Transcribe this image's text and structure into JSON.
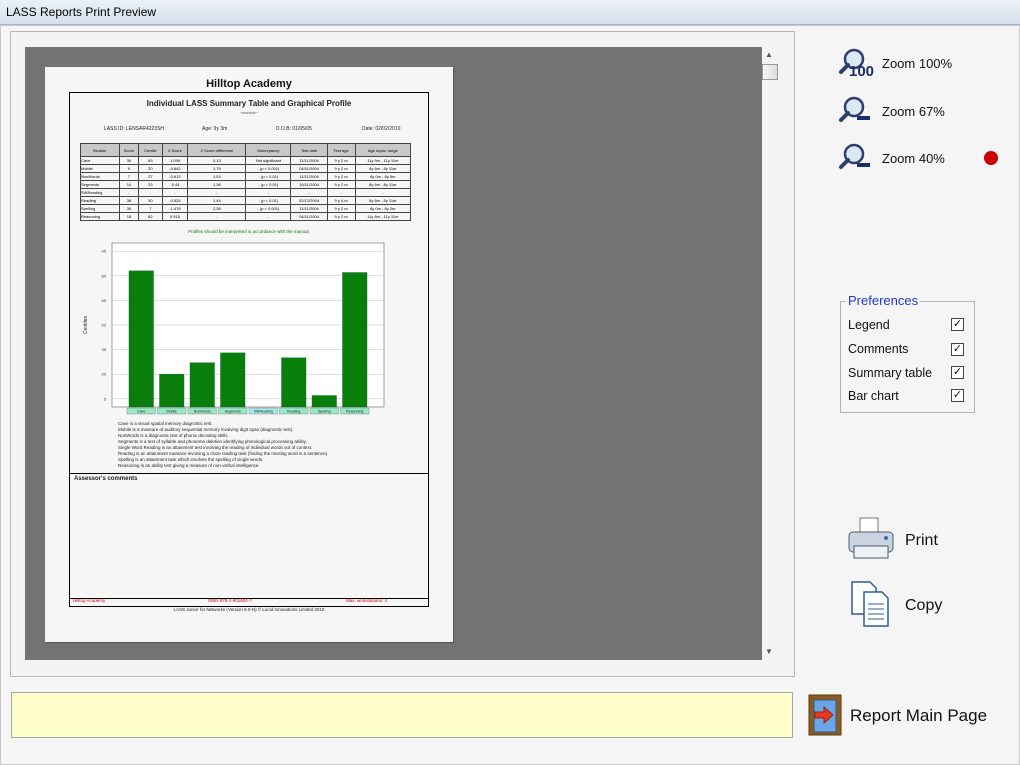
{
  "window": {
    "title": "LASS Reports Print Preview"
  },
  "zoom": {
    "items": [
      {
        "label": "Zoom 100%",
        "badge": "100"
      },
      {
        "label": "Zoom 67%",
        "badge": ""
      },
      {
        "label": "Zoom 40%",
        "badge": ""
      }
    ],
    "active_indicator_color": "#cc0000"
  },
  "preferences": {
    "title": "Preferences",
    "items": [
      {
        "label": "Legend",
        "checked": true
      },
      {
        "label": "Comments",
        "checked": true
      },
      {
        "label": "Summary table",
        "checked": true
      },
      {
        "label": "Bar chart",
        "checked": true
      }
    ],
    "check_glyph": "✓"
  },
  "actions": {
    "print_label": "Print",
    "copy_label": "Copy",
    "main_page_label": "Report Main Page"
  },
  "report": {
    "school": "Hilltop Academy",
    "title": "Individual LASS Summary Table and Graphical Profile",
    "subtitle": "~scribble~",
    "info_id": "LASS ID: LENSAR4223SH",
    "info_age": "Age:  9y  3m",
    "info_dob": "D.O.B: 01/05/05",
    "info_date": "Date: 02/02/2010",
    "table": {
      "headers": [
        "Module",
        "Score",
        "Centile",
        "Z Score",
        "Z Score difference",
        "Discrepancy",
        "Test date",
        "Test age",
        "Age equiv. range"
      ],
      "rows": [
        [
          "Cave",
          "30",
          "83",
          "1.099",
          "0.13",
          "Not significant",
          "11/11/2004",
          "9 y 2 m",
          "11y 9m - 11y 11m"
        ],
        [
          "Mobile",
          "9",
          "20",
          "-0.842",
          "1.79",
          "- (p < 0.001)",
          "04/11/2004",
          "9 y 2 m",
          "8y 6m - 8y 11m"
        ],
        [
          "NonWords",
          "7",
          "27",
          "-0.613",
          "1.53",
          "- (p < 0.01)",
          "11/11/2004",
          "9 y 2 m",
          "8y 0m - 8y 5m"
        ],
        [
          "Segments",
          "14",
          "33",
          "-0.44",
          "1.36",
          "- (p < 0.01)",
          "19/11/2004",
          "9 y 2 m",
          "8y 6m - 8y 11m"
        ],
        [
          "SWReading",
          "-",
          "-",
          "-",
          "-",
          "-",
          "-",
          "-",
          "-"
        ],
        [
          "Reading",
          "38",
          "30",
          "-0.525",
          "1.44",
          "- (p < 0.01)",
          "02/12/2004",
          "9 y 4 m",
          "8y 6m - 8y 11m"
        ],
        [
          "Spelling",
          "30",
          "7",
          "-1.476",
          "2.38",
          "- (p < 0.001)",
          "11/11/2004",
          "9 y 2 m",
          "8y 0m - 8y 2m"
        ],
        [
          "Reasoning",
          "18",
          "82",
          "0.915",
          "-",
          "-",
          "04/11/2004",
          "9 y 2 m",
          "11y 6m - 11y 11m"
        ]
      ]
    },
    "profile_note": "Profiles should be interpreted in accordance with the manual.",
    "legend_lines": [
      "Cave is a visual spatial memory diagnostic test.",
      "Mobile is a measure of auditory sequential memory involving digit span (diagnostic test).",
      "NonWords is a diagnostic test of phonic decoding skills.",
      "Segments is a test of syllable and phoneme deletion identifying phonological processing ability.",
      "Single Word Reading is an attainment test involving the reading of individual words out of context.",
      "Reading is an attainment measure involving a cloze reading task (finding the missing word in a sentence).",
      "Spelling is an attainment task which involves the spelling of single words.",
      "Reasoning is an ability test giving a measure of non-verbal intelligence."
    ],
    "comments_title": "Assessor's comments",
    "footer_left": "Hilltop Academy",
    "footer_mid": "ISBN 978-1-901604-?",
    "footer_right": "Max. workstations: 4",
    "copyright": "LASS Junior for Networks (Version 6.0-N)   © Lucid Innovations Limited 2010"
  },
  "chart_data": {
    "type": "bar",
    "ylabel": "Centiles",
    "yticks": [
      5,
      20,
      35,
      50,
      65,
      80,
      95
    ],
    "ylim": [
      0,
      100
    ],
    "categories": [
      "Cave",
      "Mobile",
      "NonWords",
      "Segments",
      "SWReading",
      "Reading",
      "Spelling",
      "Reasoning"
    ],
    "values": [
      83,
      20,
      27,
      33,
      null,
      30,
      7,
      82
    ],
    "bar_color": "#0a7e0a",
    "label_bg_colors": [
      "#9be8c8",
      "#9be8c8",
      "#9be8c8",
      "#9be8c8",
      "#a8e8e8",
      "#9be8c8",
      "#9be8c8",
      "#9be8c8"
    ]
  }
}
